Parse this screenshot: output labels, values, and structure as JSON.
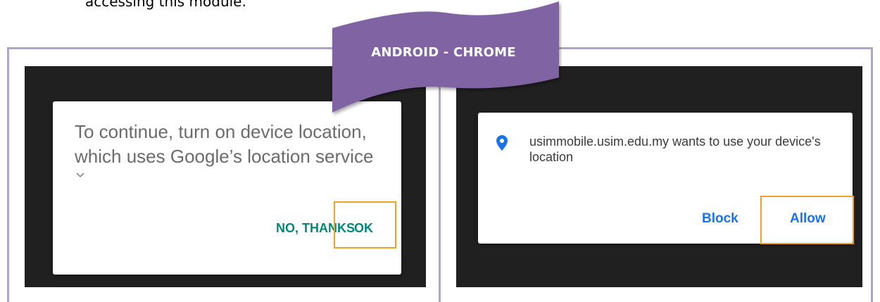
{
  "intro_text": "accessing this module.",
  "banner": {
    "label": "ANDROID - CHROME",
    "color": "#8064a2"
  },
  "colors": {
    "frame": "#b3a2cc",
    "screen_bg": "#202020",
    "highlight": "#f0a12a",
    "teal": "#00897b",
    "blue": "#1a73e8"
  },
  "left_dialog": {
    "message": "To continue, turn on device location, which uses Google’s location service",
    "expand_icon": "chevron-down-icon",
    "no_thanks_label": "NO, THANKS",
    "ok_label": "OK"
  },
  "right_dialog": {
    "icon": "location-pin-icon",
    "message": "usimmobile.usim.edu.my wants to use your device's location",
    "block_label": "Block",
    "allow_label": "Allow"
  }
}
